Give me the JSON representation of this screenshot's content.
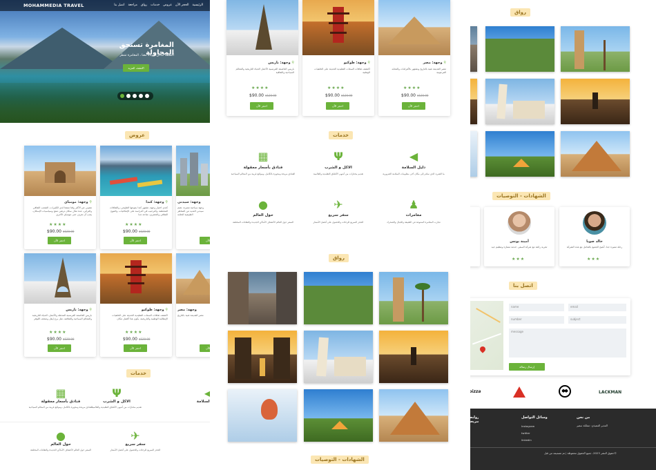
{
  "nav": {
    "brand": "MOHAMMEDIA TRAVEL",
    "links": [
      "الرئيسية",
      "الحجز الآن",
      "عروض",
      "خدمات",
      "رواق",
      "مراجعة",
      "اتصل بنا"
    ]
  },
  "hero": {
    "title": "المغامرة تستحق المحاولة",
    "subtitle": "اكتشف أماكن جديدة معنا ، المغامرة تنتظر",
    "button": "اكتشف المزيد",
    "dots": 5
  },
  "sections": {
    "offers": "عروض",
    "services": "خدمات",
    "gallery": "رواق",
    "testimonials": "الشهادات - التوصيات",
    "contact": "اتصل بنا"
  },
  "offers": {
    "cards": [
      {
        "title": "وجهة: مومباي",
        "text": "تنقيبي عن الأكثر وقتا ممتعا لدى الكثيرات، الشعب الثقافي والتراثي، عدة مثال سكان ترتقي منتج وسياسيات الإسكان، يجب أن تعرف حتى مومباي الأخرى",
        "rating": "★★★★",
        "price": "$90.00",
        "old": "$120.00",
        "btn": "احجز الآن"
      },
      {
        "title": "وجهة: كندا",
        "text": "كندي اختيار وجهة، تشتهر كندا بتنوعها الطبيعي، والثقافات المختلفة، والترحيب في الدراسة على الإمكانيات، والتنوع الثقافي والحضري، متاحة جدا",
        "rating": "★★★★",
        "price": "$90.00",
        "old": "$120.00",
        "btn": "احجز الآن"
      },
      {
        "title": "وجهة: سيدني",
        "text": "وجهة سياحية مميزة، تضم سيدني العديد من المناظر الطبيعية الخلابة",
        "rating": "★★★★",
        "price": "$90.00",
        "old": "$120.00",
        "btn": "احجز الآن"
      },
      {
        "title": "وجهة: باريس",
        "text": "باريس العاصمة الفرنسية المذهلة والأجمل، الحياة التاريخية والمعالم السياحية والثقافية، مثل برج إيفل ومتحف اللوفر",
        "rating": "★★★★",
        "price": "$90.00",
        "old": "$120.00",
        "btn": "احجز الآن"
      },
      {
        "title": "وجهة: طوكيو",
        "text": "اكتشف ثقافات السعات التقليدية الحديثة على الخلفيات الإيطالية الوطنية والتاريخية، يكون هذا أفضل مكان",
        "rating": "★★★★",
        "price": "$90.00",
        "old": "$120.00",
        "btn": "احجز الآن"
      },
      {
        "title": "وجهة: مصر",
        "text": "مصر القديمة غنية بالتاريخ",
        "rating": "★★★★",
        "price": "$90.00",
        "old": "$120.00",
        "btn": "احجز الآن"
      }
    ]
  },
  "col2cards": [
    {
      "title": "وجهة: باريس",
      "text": "باريس العاصمة الفرنسية الأجمل الحياة التاريخية والمعالم السياحية والثقافية",
      "rating": "★★★★",
      "price": "$90.00",
      "old": "$120.00",
      "btn": "احجز الآن"
    },
    {
      "title": "وجهة: طوكيو",
      "text": "اكتشف ثقافات السعات التقليدية الحديثة على الخلفيات الوطنية",
      "rating": "★★★★",
      "price": "$90.00",
      "old": "$120.00",
      "btn": "احجز الآن"
    },
    {
      "title": "وجهة: مصر",
      "text": "مصر القديمة غنية بالتاريخ وتشتهر بالأهرامات والمعابد الفرعونية",
      "rating": "★★★★",
      "price": "$90.00",
      "old": "$120.00",
      "btn": "احجز الآن"
    }
  ],
  "services": [
    {
      "icon": "building-icon",
      "glyph": "▦",
      "title": "فنادق بأسعار معقولة",
      "text": "الفنادق مريحة ومجهزة بالكامل، ومواقع قريبة من المعالم السياحية"
    },
    {
      "icon": "utensils-icon",
      "glyph": "Ψ",
      "title": "الاكل و الشرب",
      "text": "تقديم مختارات من أشهى الأطباق التقليدية والعالمية"
    },
    {
      "icon": "megaphone-icon",
      "glyph": "◀",
      "title": "دليل السلامة",
      "text": "ما الشيء الذي سافر إلى مكان آخر، معلومات السلامة الضرورية"
    },
    {
      "icon": "globe-icon",
      "glyph": "●",
      "title": "حول العالم",
      "text": "السفر حول العالم لاكتشاف الأماكن الجديدة والثقافات المختلفة"
    },
    {
      "icon": "plane-icon",
      "glyph": "✈",
      "title": "سفر سريع",
      "text": "الحجز السريع للرحلات والحصول على أفضل الأسعار"
    },
    {
      "icon": "hiker-icon",
      "glyph": "♟",
      "title": "مغامرات",
      "text": "تجارب المغامرة المتنوعة في الطبيعة والجبال والصحراء"
    }
  ],
  "testimonials": [
    {
      "name": "أمينة يونس",
      "text": "تجربة رائعة مع شركة السفر، خدمة ممتازة وتنظيم جيد",
      "rating": "★★★"
    },
    {
      "name": "خالد صويا",
      "text": "رحلة مميزة جدا، أنصح الجميع بالتعامل مع هذه الشركة",
      "rating": "★★★"
    }
  ],
  "contact": {
    "name": "name",
    "email": "email",
    "number": "number",
    "subject": "subject",
    "message": "message",
    "send": "إرسال رسالة"
  },
  "brands": [
    "pizza",
    "mountain",
    "panda",
    "LACKMAN"
  ],
  "footer": {
    "about_title": "من نحن",
    "about_text": "المدير التنفيذي: مملكة سفير",
    "social_title": "وسائل التواصل",
    "social": [
      "Instagram",
      "twitter",
      "linkedin"
    ],
    "links_title": "روابط سريعة",
    "copyright": "©حقوق النشر 2023، جميع الحقوق محفوظة | تم تصميمه من قبل"
  },
  "colors": {
    "accent": "#6bb33a",
    "section_bg": "#fbe6b3",
    "footer_bg": "#2b2b2b"
  }
}
